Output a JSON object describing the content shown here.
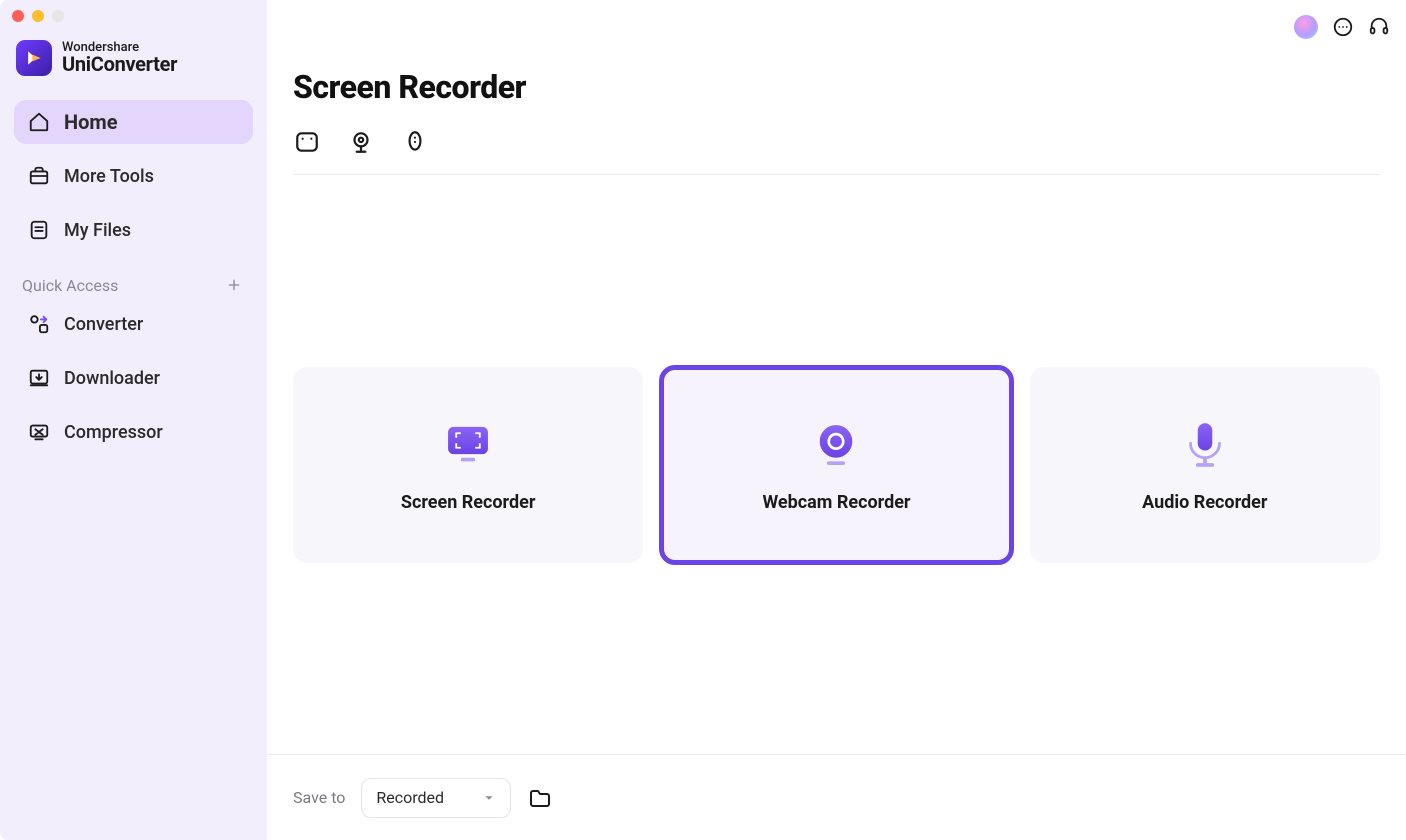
{
  "brand": {
    "line1": "Wondershare",
    "line2": "UniConverter"
  },
  "sidebar": {
    "items": [
      {
        "label": "Home"
      },
      {
        "label": "More Tools"
      },
      {
        "label": "My Files"
      }
    ],
    "quick_access_label": "Quick Access",
    "quick_items": [
      {
        "label": "Converter"
      },
      {
        "label": "Downloader"
      },
      {
        "label": "Compressor"
      }
    ]
  },
  "page": {
    "title": "Screen Recorder"
  },
  "cards": [
    {
      "label": "Screen Recorder"
    },
    {
      "label": "Webcam Recorder"
    },
    {
      "label": "Audio Recorder"
    }
  ],
  "bottom": {
    "save_label": "Save to",
    "dropdown_value": "Recorded"
  }
}
